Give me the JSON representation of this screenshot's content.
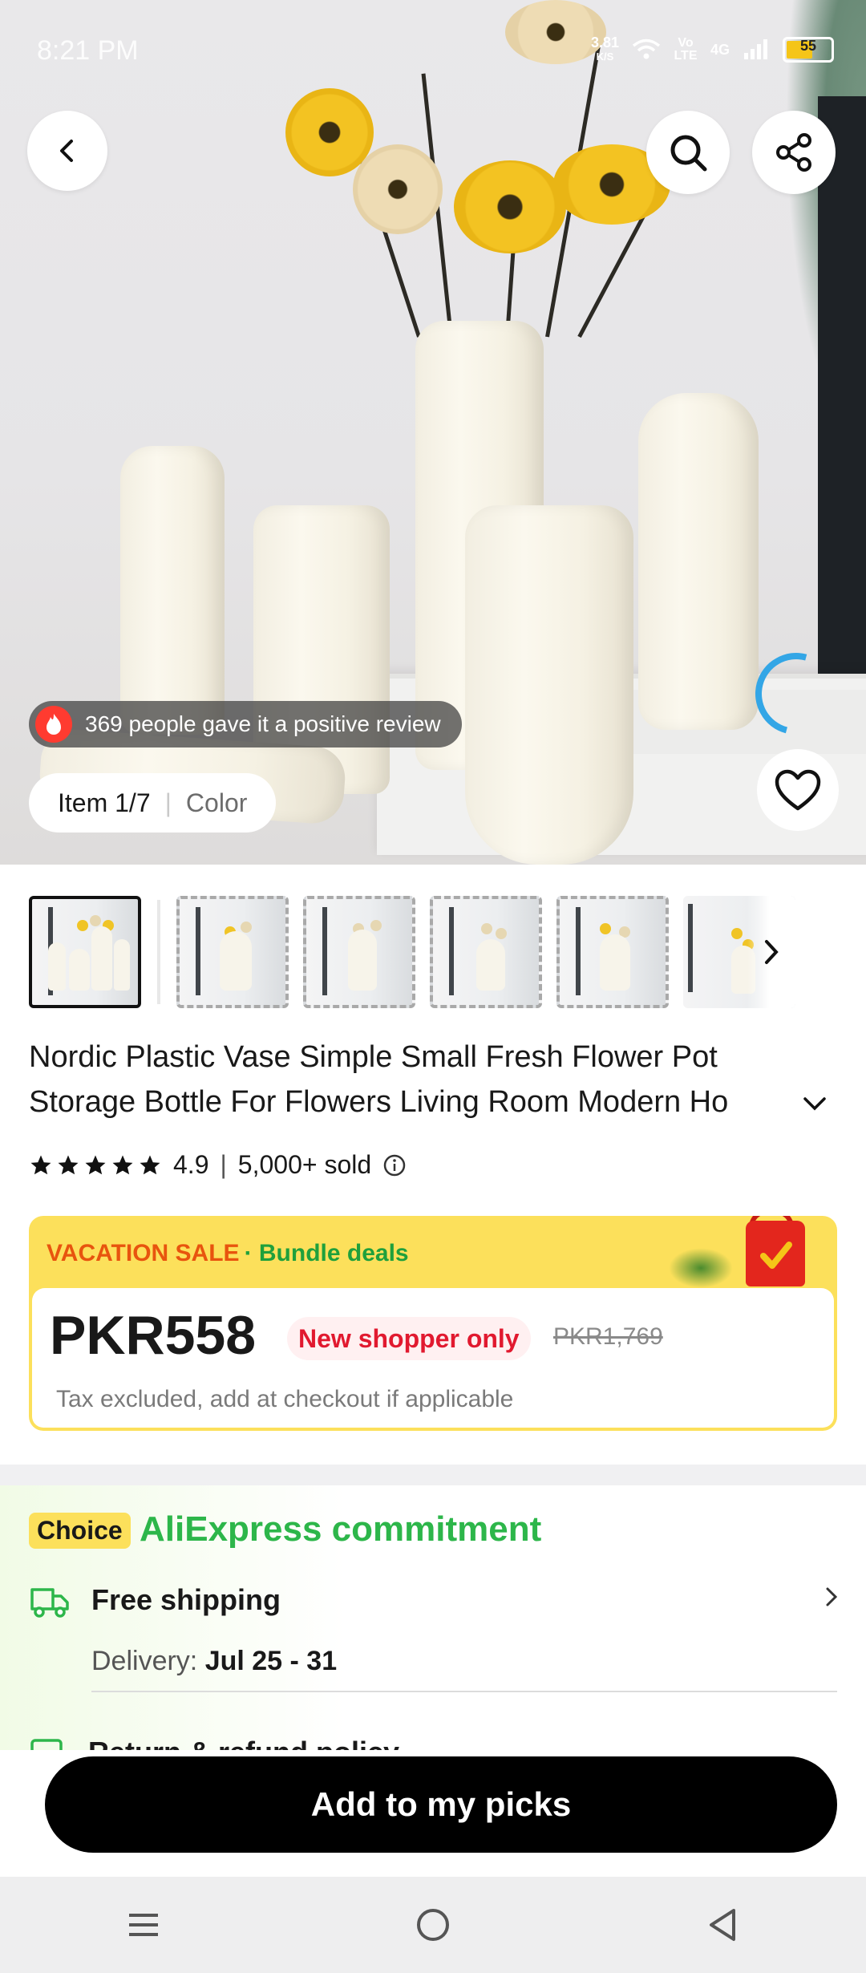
{
  "status_bar": {
    "time": "8:21 PM",
    "net_speed": "3.81",
    "net_unit": "K/S",
    "volte": "Vo LTE",
    "network": "4G",
    "battery": "55"
  },
  "gallery": {
    "review_text": "369 people gave it a positive review",
    "item_label": "Item 1/7",
    "color_label": "Color"
  },
  "product": {
    "title": "Nordic Plastic Vase Simple Small Fresh Flower Pot Storage Bottle For Flowers Living Room Modern Ho",
    "rating": "4.9",
    "sold": "5,000+ sold"
  },
  "price_card": {
    "vacation": "VACATION SALE",
    "bundle": "· Bundle deals",
    "price": "PKR558",
    "badge": "New shopper only",
    "old_price": "PKR1,769",
    "tax_note": "Tax excluded, add at checkout if applicable"
  },
  "commitment": {
    "choice": "Choice",
    "title": "AliExpress commitment",
    "shipping": "Free shipping",
    "delivery_label": "Delivery:",
    "delivery_dates": "Jul 25 - 31",
    "next_row": "Return & refund policy"
  },
  "cta": {
    "label": "Add to my picks"
  },
  "colors": {
    "accent_red": "#e1192f",
    "green": "#2db64a",
    "yellow": "#fce05b",
    "orange": "#e8540e"
  }
}
